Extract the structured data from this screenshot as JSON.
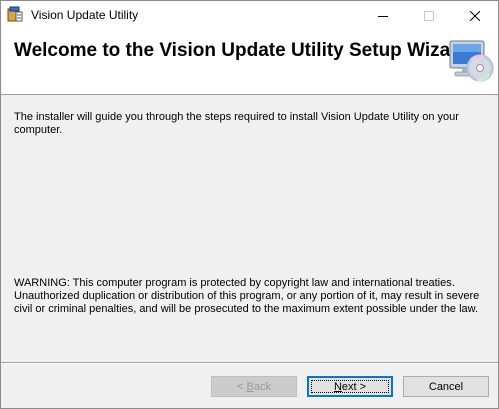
{
  "window": {
    "title": "Vision Update Utility",
    "controls": {
      "minimize_icon": "minimize-icon",
      "maximize_icon": "maximize-icon",
      "close_icon": "close-icon"
    }
  },
  "header": {
    "title": "Welcome to the Vision Update Utility Setup Wizard",
    "icon": "computer-cd-icon"
  },
  "body": {
    "intro": "The installer will guide you through the steps required to install Vision Update Utility on your computer.",
    "warning": "WARNING: This computer program is protected by copyright law and international treaties. Unauthorized duplication or distribution of this program, or any portion of it, may result in severe civil or criminal penalties, and will be prosecuted to the maximum extent possible under the law."
  },
  "buttons": {
    "back": {
      "prefix": "< ",
      "mnemonic": "B",
      "rest": "ack",
      "enabled": false
    },
    "next": {
      "mnemonic": "N",
      "rest": "ext >",
      "focused": true
    },
    "cancel": {
      "label": "Cancel"
    }
  },
  "colors": {
    "focus_border": "#0078d7",
    "banner_bg": "#ffffff",
    "dialog_bg": "#f0f0f0"
  }
}
